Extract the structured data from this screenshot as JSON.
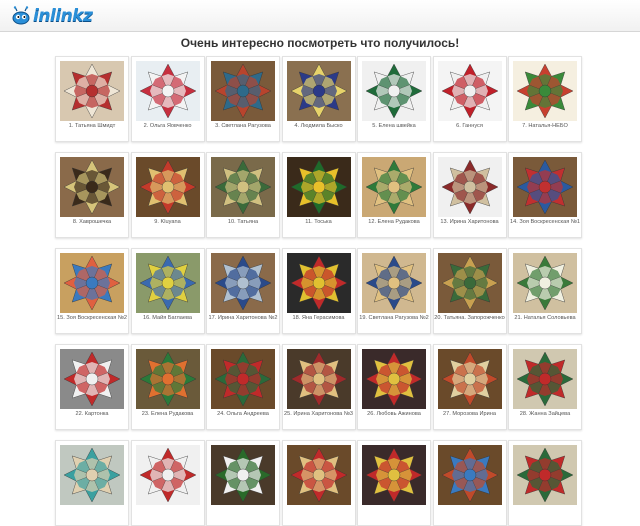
{
  "header": {
    "logo_text": "inlinkz"
  },
  "title": "Очень интересно посмотреть  что получилось!",
  "entries": [
    {
      "caption": "1. Татьяна Шмидт",
      "bg": "#d8c8b0",
      "c1": "#efe6d6",
      "c2": "#b52f2f"
    },
    {
      "caption": "2. Ольга Яовченко",
      "bg": "#e8eef2",
      "c1": "#c62f3f",
      "c2": "#f3f3f3"
    },
    {
      "caption": "3. Светлана Рагузова",
      "bg": "#7a5a3a",
      "c1": "#b8442d",
      "c2": "#2e6a8a"
    },
    {
      "caption": "4. Людмила Быско",
      "bg": "#8a7050",
      "c1": "#e7d36a",
      "c2": "#2b3a88"
    },
    {
      "caption": "5. Елена швейка",
      "bg": "#f0f0f0",
      "c1": "#1f6b3a",
      "c2": "#f0f0f0"
    },
    {
      "caption": "6. Ганнуся",
      "bg": "#f4f4f4",
      "c1": "#c0202a",
      "c2": "#f0f0f0"
    },
    {
      "caption": "7. Наталья-НЕБО",
      "bg": "#f5efe0",
      "c1": "#c7402f",
      "c2": "#3a8a3a"
    },
    {
      "caption": "8. Хаврошечка",
      "bg": "#8a6a4a",
      "c1": "#d6c47a",
      "c2": "#3a2a1a"
    },
    {
      "caption": "9. Kluyana",
      "bg": "#6a4a2a",
      "c1": "#c43a2a",
      "c2": "#e0c070"
    },
    {
      "caption": "10. Татьяна",
      "bg": "#7a6a4a",
      "c1": "#3a6a3a",
      "c2": "#d0c080"
    },
    {
      "caption": "11. Тоська",
      "bg": "#3a2a1a",
      "c1": "#1f6a2a",
      "c2": "#e8c02a"
    },
    {
      "caption": "12. Елена Рудакова",
      "bg": "#caa874",
      "c1": "#2e7a3a",
      "c2": "#e0c080"
    },
    {
      "caption": "13. Ирина Харитонова",
      "bg": "#f0f0f0",
      "c1": "#8a2a2a",
      "c2": "#d0c0a0"
    },
    {
      "caption": "14. Зоя Воскресенская №1",
      "bg": "#7a5a3a",
      "c1": "#2a5aa0",
      "c2": "#c03030"
    },
    {
      "caption": "15. Зоя Воскресенская №2",
      "bg": "#c8a060",
      "c1": "#e06040",
      "c2": "#3a7ac0"
    },
    {
      "caption": "16. Майя Баглаева",
      "bg": "#8a9a6a",
      "c1": "#3a6ab0",
      "c2": "#e0d040"
    },
    {
      "caption": "17. Ирина Харитонова №2",
      "bg": "#8a6a4a",
      "c1": "#2a4a8a",
      "c2": "#b0c0d0"
    },
    {
      "caption": "18. Яна Герасимова",
      "bg": "#2a2a2a",
      "c1": "#c02a2a",
      "c2": "#e0c030"
    },
    {
      "caption": "19. Светлана Рагузова №2",
      "bg": "#d0b890",
      "c1": "#2a4a8a",
      "c2": "#e0c080"
    },
    {
      "caption": "20. Татьяна. Запорожченко",
      "bg": "#7a5a3a",
      "c1": "#c8a050",
      "c2": "#3a6a3a"
    },
    {
      "caption": "21. Наталья Соловьева",
      "bg": "#d0c0a0",
      "c1": "#3a7a3a",
      "c2": "#f0f0e0"
    },
    {
      "caption": "22. Картонка",
      "bg": "#8a8a8a",
      "c1": "#c02a2a",
      "c2": "#f0f0f0"
    },
    {
      "caption": "23. Елена Рудакова",
      "bg": "#6a5a3a",
      "c1": "#2a7a3a",
      "c2": "#e07030"
    },
    {
      "caption": "24. Ольга Андреева",
      "bg": "#6a4a2a",
      "c1": "#2a6a3a",
      "c2": "#c02a2a"
    },
    {
      "caption": "25. Ирина Харитонова №3",
      "bg": "#4a3a2a",
      "c1": "#a02a2a",
      "c2": "#e0c080"
    },
    {
      "caption": "26. Любовь Ажинова",
      "bg": "#3a2a2a",
      "c1": "#c02a2a",
      "c2": "#e0c040"
    },
    {
      "caption": "27. Морозова Ирина",
      "bg": "#6a4a2a",
      "c1": "#c04a2a",
      "c2": "#e0d0a0"
    },
    {
      "caption": "28. Жанна Зайцева",
      "bg": "#d0c8b0",
      "c1": "#2a6a3a",
      "c2": "#c02a2a"
    },
    {
      "caption": "",
      "bg": "#c0c8c0",
      "c1": "#3aa0a0",
      "c2": "#e0d0b0"
    },
    {
      "caption": "",
      "bg": "#f0f0f0",
      "c1": "#c02a2a",
      "c2": "#f0f0f0"
    },
    {
      "caption": "",
      "bg": "#4a3a2a",
      "c1": "#2a6a2a",
      "c2": "#f0f0f0"
    },
    {
      "caption": "",
      "bg": "#6a4a2a",
      "c1": "#c02a2a",
      "c2": "#e0c080"
    },
    {
      "caption": "",
      "bg": "#3a2a2a",
      "c1": "#c02a2a",
      "c2": "#e0c040"
    },
    {
      "caption": "",
      "bg": "#6a4a2a",
      "c1": "#c04a2a",
      "c2": "#3a7ac0"
    },
    {
      "caption": "",
      "bg": "#d0c8b0",
      "c1": "#2a6a3a",
      "c2": "#c02a2a"
    }
  ]
}
